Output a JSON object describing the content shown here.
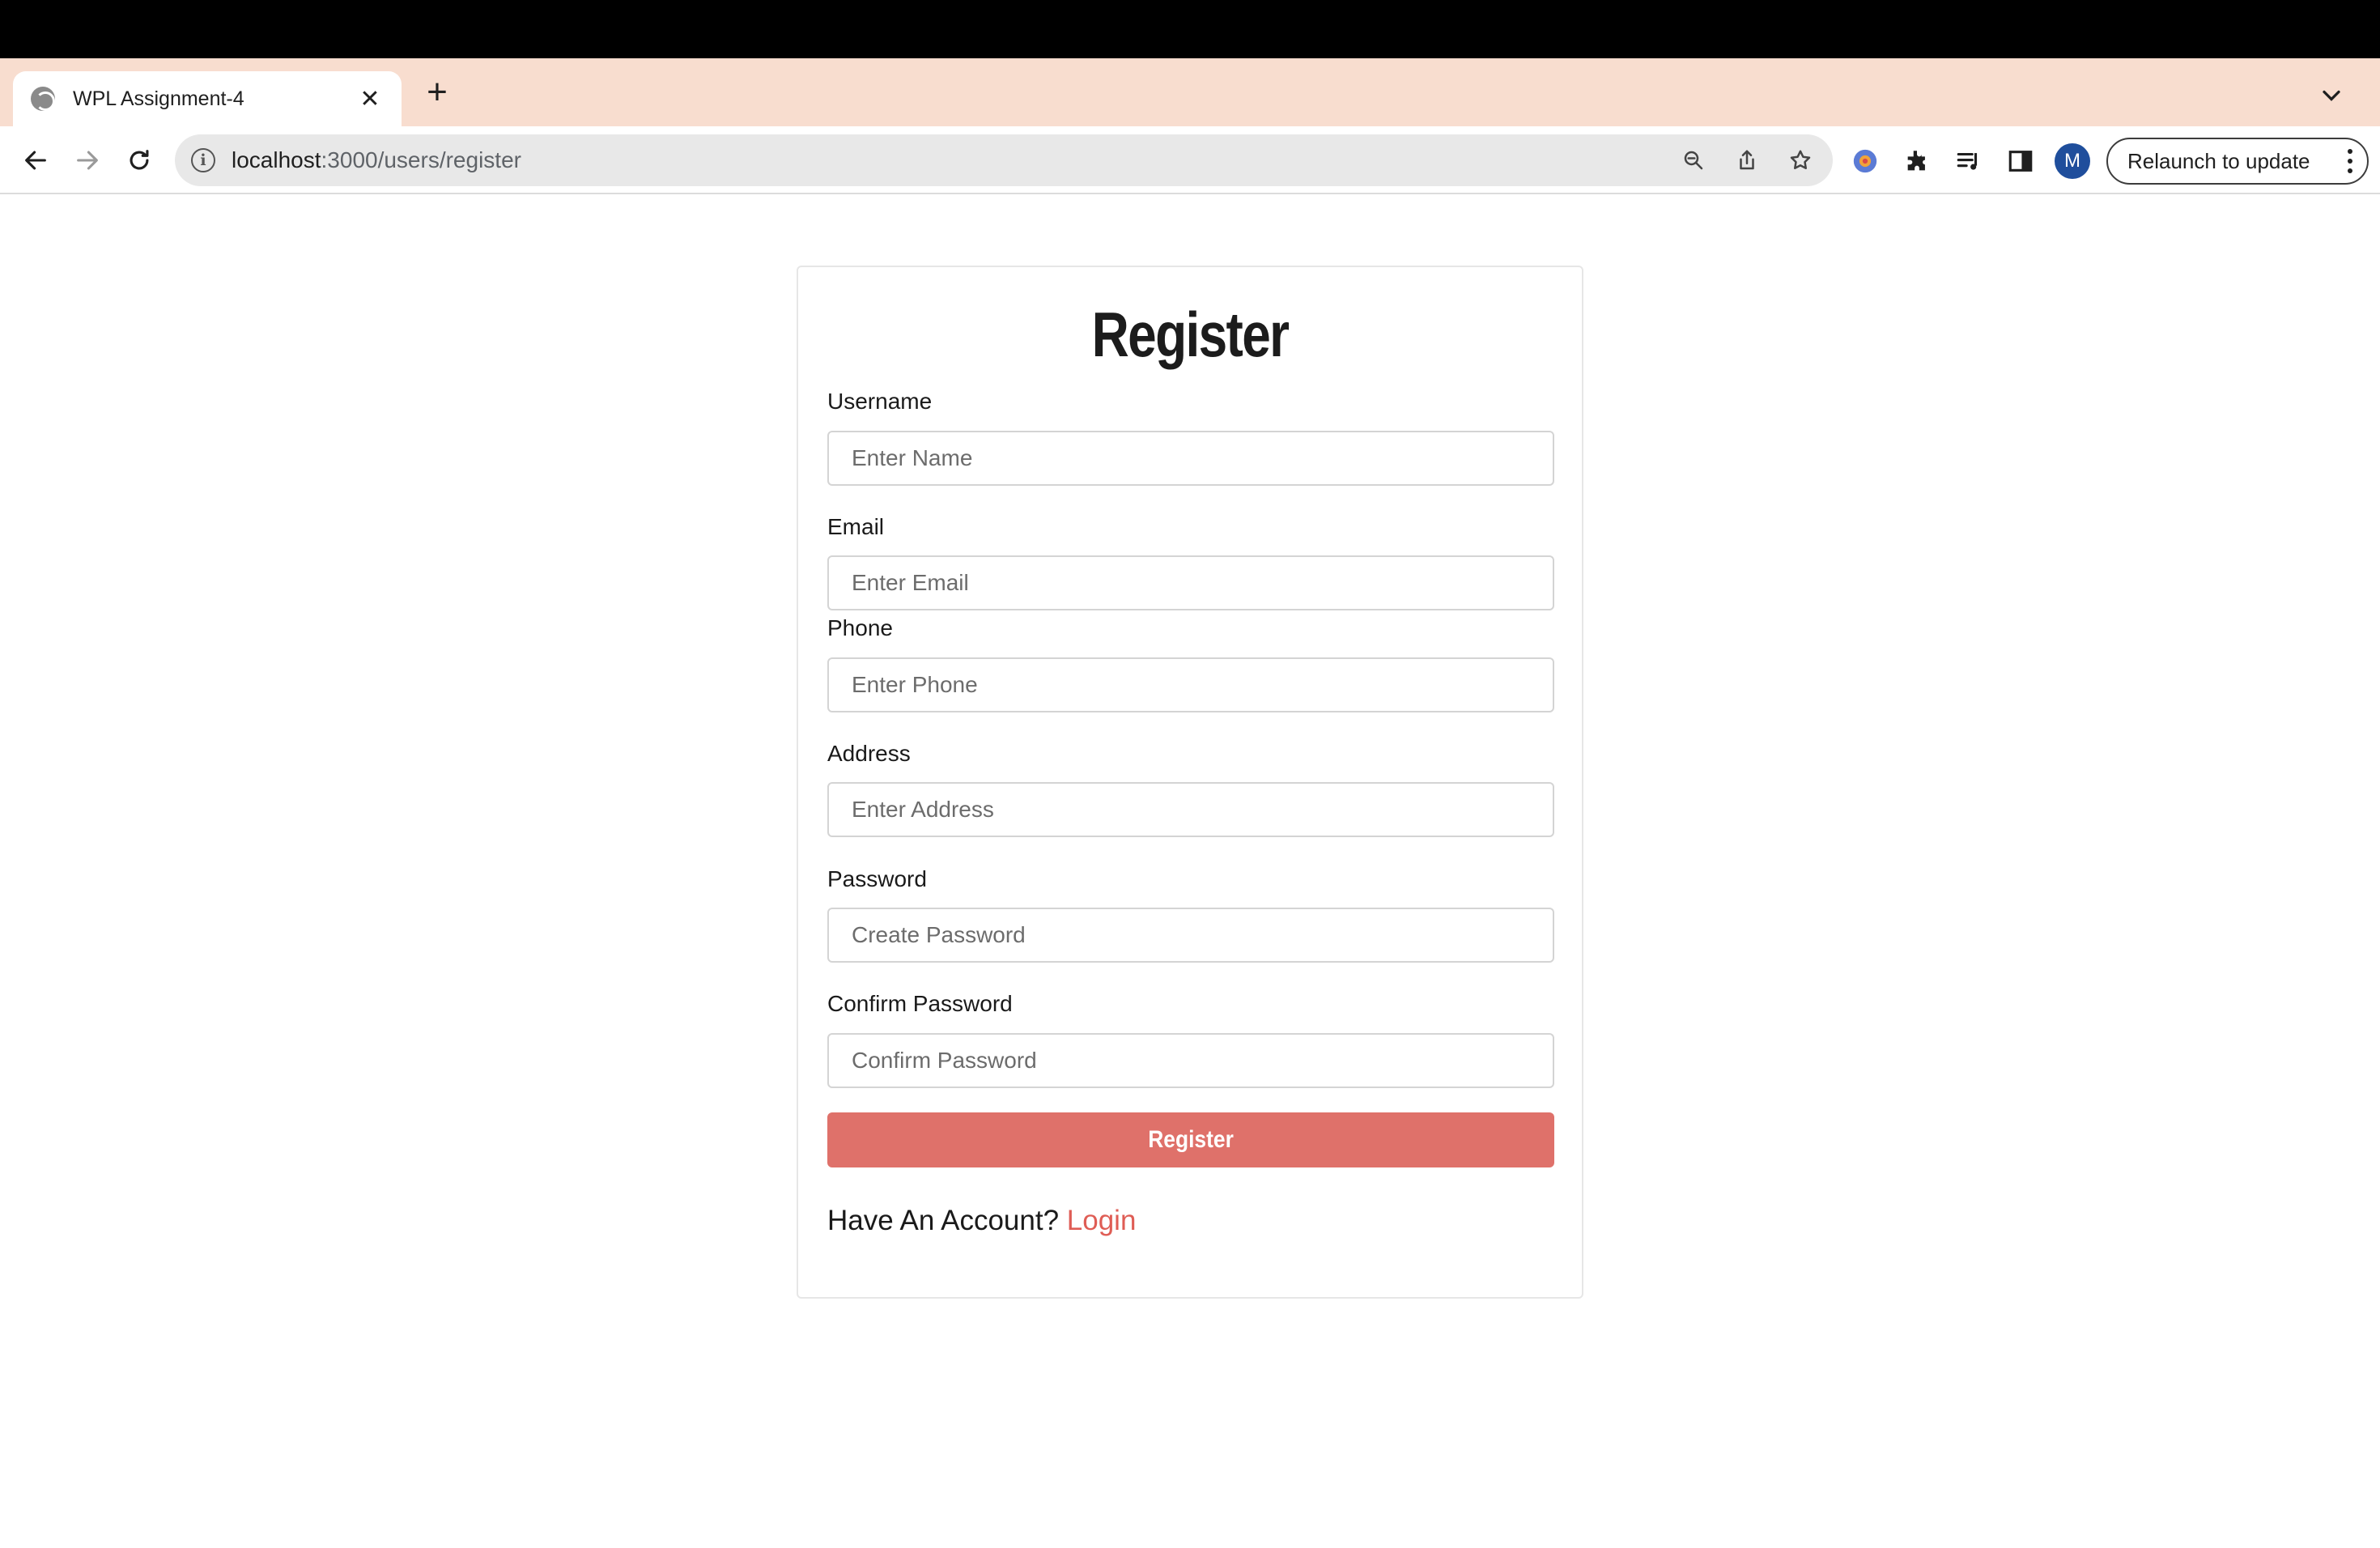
{
  "browser": {
    "tab_title": "WPL Assignment-4",
    "new_tab_symbol": "+",
    "close_symbol": "✕",
    "url_host": "localhost",
    "url_path": ":3000/users/register",
    "profile_initial": "M",
    "relaunch_label": "Relaunch to update",
    "tab_strip_color": "#f8ddcf",
    "avatar_color": "#1f4e9c"
  },
  "page": {
    "heading": "Register",
    "fields": {
      "username": {
        "label": "Username",
        "placeholder": "Enter Name"
      },
      "email": {
        "label": "Email",
        "placeholder": "Enter Email"
      },
      "phone": {
        "label": "Phone",
        "placeholder": "Enter Phone"
      },
      "address": {
        "label": "Address",
        "placeholder": "Enter Address"
      },
      "password": {
        "label": "Password",
        "placeholder": "Create Password"
      },
      "confirm_password": {
        "label": "Confirm Password",
        "placeholder": "Confirm Password"
      }
    },
    "submit_label": "Register",
    "have_account_text": "Have An Account?",
    "login_link": "Login",
    "button_color": "#df716a",
    "link_color": "#df5d55"
  }
}
